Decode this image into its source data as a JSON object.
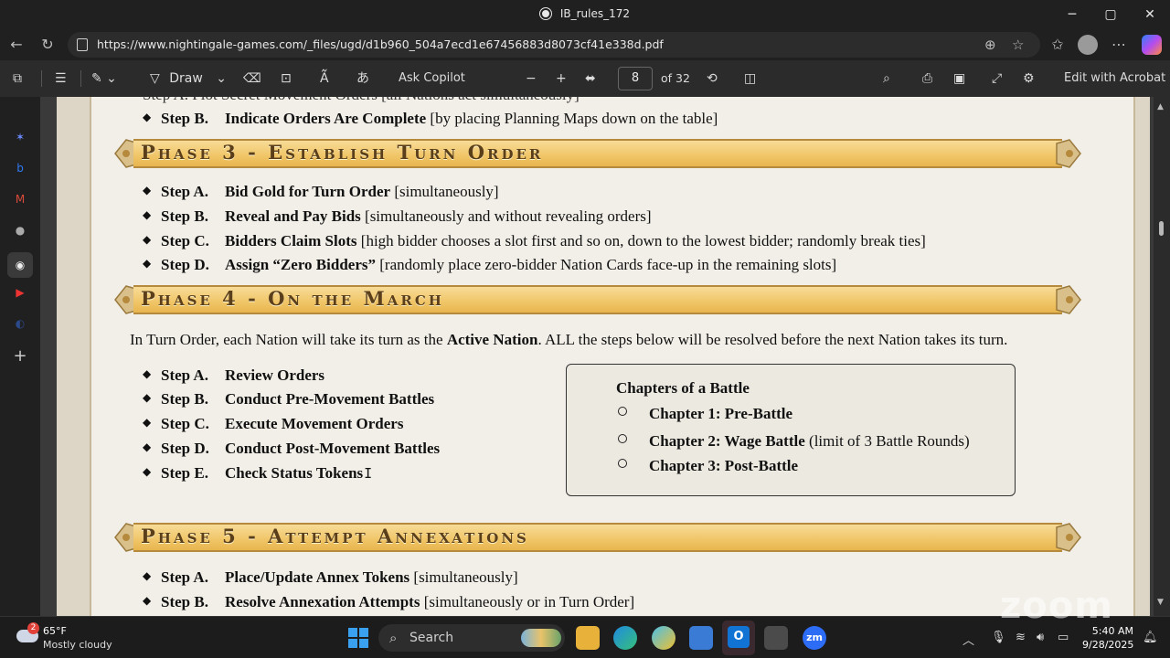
{
  "window": {
    "title": "IB_rules_172",
    "minimize": "─",
    "maximize": "▢",
    "close": "✕"
  },
  "address": {
    "url": "https://www.nightingale-games.com/_files/ugd/d1b960_504a7ecd1e67456883d8073cf41e338d.pdf"
  },
  "pdf_toolbar": {
    "draw_label": "Draw",
    "ask_copilot": "Ask Copilot",
    "page_current": "8",
    "page_total": "of 32",
    "edit_acrobat": "Edit with Acrobat"
  },
  "doc": {
    "partial_top": "Step A.   Plot Secret Movement Orders [all Nations act simultaneously]",
    "phase2_stepB": {
      "label": "Step B.",
      "bold": "Indicate Orders Are Complete",
      "rest": " [by placing Planning Maps down on the table]"
    },
    "phase3": {
      "heading": "Phase 3 - Establish Turn Order",
      "steps": [
        {
          "label": "Step A.",
          "bold": "Bid Gold for Turn Order",
          "rest": " [simultaneously]"
        },
        {
          "label": "Step B.",
          "bold": "Reveal and Pay Bids",
          "rest": " [simultaneously and without revealing orders]"
        },
        {
          "label": "Step C.",
          "bold": "Bidders Claim Slots",
          "rest": " [high bidder chooses a slot first and so on, down to the lowest bidder; randomly break ties]"
        },
        {
          "label": "Step D.",
          "bold": "Assign “Zero Bidders”",
          "rest": " [randomly place zero-bidder Nation Cards face-up in the remaining slots]"
        }
      ]
    },
    "phase4": {
      "heading": "Phase 4 - On the March",
      "intro_pre": "In Turn Order, each Nation will take its turn as the ",
      "intro_bold": "Active Nation",
      "intro_post": ".  ALL the steps below will be resolved before the next Nation takes its turn.",
      "steps": [
        {
          "label": "Step A.",
          "bold": "Review Orders"
        },
        {
          "label": "Step B.",
          "bold": "Conduct Pre-Movement Battles"
        },
        {
          "label": "Step C.",
          "bold": "Execute Movement Orders"
        },
        {
          "label": "Step D.",
          "bold": "Conduct Post-Movement Battles"
        },
        {
          "label": "Step E.",
          "bold": "Check Status Tokens"
        }
      ],
      "battle_box": {
        "title": "Chapters of a Battle",
        "items": [
          {
            "bold": "Chapter 1:  Pre-Battle",
            "rest": ""
          },
          {
            "bold": "Chapter 2:  Wage Battle",
            "rest": " (limit of 3 Battle Rounds)"
          },
          {
            "bold": "Chapter 3:  Post-Battle",
            "rest": ""
          }
        ]
      }
    },
    "phase5": {
      "heading": "Phase 5 - Attempt Annexations",
      "steps": [
        {
          "label": "Step A.",
          "bold": "Place/Update Annex Tokens",
          "rest": " [simultaneously]"
        },
        {
          "label": "Step B.",
          "bold": "Resolve Annexation Attempts",
          "rest": " [simultaneously or in Turn Order]"
        }
      ]
    }
  },
  "taskbar": {
    "weather_temp": "65°F",
    "weather_desc": "Mostly cloudy",
    "weather_badge": "2",
    "search_label": "Search",
    "time": "5:40 AM",
    "date": "9/28/2025"
  },
  "overlay": {
    "zoom_watermark": "zoom"
  },
  "colors": {
    "banner_gold": "#f0c567",
    "banner_text": "#5a3f1a",
    "page_bg": "#f2efe8"
  }
}
